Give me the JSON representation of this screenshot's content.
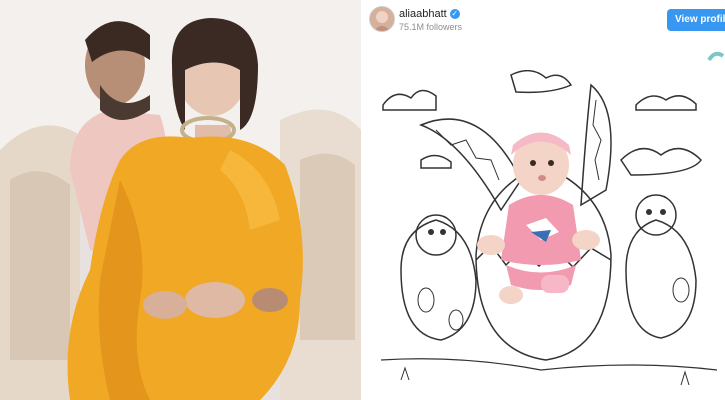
{
  "profile": {
    "username": "aliaabhatt",
    "verified_icon": "verified-badge-icon",
    "followers": "75.1M followers",
    "view_button": "View profile"
  },
  "colors": {
    "accent": "#3897f0",
    "saree": "#f1a824",
    "baby_outfit": "#f19ab0"
  }
}
